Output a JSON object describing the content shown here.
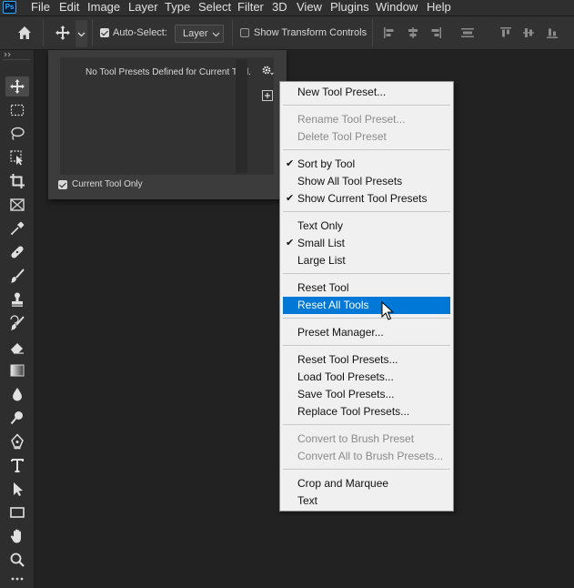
{
  "menubar": {
    "logo": "Ps",
    "items": [
      "File",
      "Edit",
      "Image",
      "Layer",
      "Type",
      "Select",
      "Filter",
      "3D",
      "View",
      "Plugins",
      "Window",
      "Help"
    ]
  },
  "optbar": {
    "auto_select_label": "Auto-Select:",
    "auto_select_checked": true,
    "layer_select_value": "Layer",
    "show_transform_label": "Show Transform Controls",
    "show_transform_checked": false
  },
  "panel": {
    "empty_text": "No Tool Presets Defined for Current Tool.",
    "current_tool_only_label": "Current Tool Only",
    "current_tool_only_checked": true
  },
  "menu": {
    "items": [
      {
        "label": "New Tool Preset...",
        "enabled": true,
        "checked": false,
        "highlighted": false
      },
      {
        "label": "Rename Tool Preset...",
        "enabled": false,
        "checked": false,
        "highlighted": false
      },
      {
        "label": "Delete Tool Preset",
        "enabled": false,
        "checked": false,
        "highlighted": false
      },
      {
        "label": "Sort by Tool",
        "enabled": true,
        "checked": true,
        "highlighted": false
      },
      {
        "label": "Show All Tool Presets",
        "enabled": true,
        "checked": false,
        "highlighted": false
      },
      {
        "label": "Show Current Tool Presets",
        "enabled": true,
        "checked": true,
        "highlighted": false
      },
      {
        "label": "Text Only",
        "enabled": true,
        "checked": false,
        "highlighted": false
      },
      {
        "label": "Small List",
        "enabled": true,
        "checked": true,
        "highlighted": false
      },
      {
        "label": "Large List",
        "enabled": true,
        "checked": false,
        "highlighted": false
      },
      {
        "label": "Reset Tool",
        "enabled": true,
        "checked": false,
        "highlighted": false
      },
      {
        "label": "Reset All Tools",
        "enabled": true,
        "checked": false,
        "highlighted": true
      },
      {
        "label": "Preset Manager...",
        "enabled": true,
        "checked": false,
        "highlighted": false
      },
      {
        "label": "Reset Tool Presets...",
        "enabled": true,
        "checked": false,
        "highlighted": false
      },
      {
        "label": "Load Tool Presets...",
        "enabled": true,
        "checked": false,
        "highlighted": false
      },
      {
        "label": "Save Tool Presets...",
        "enabled": true,
        "checked": false,
        "highlighted": false
      },
      {
        "label": "Replace Tool Presets...",
        "enabled": true,
        "checked": false,
        "highlighted": false
      },
      {
        "label": "Convert to Brush Preset",
        "enabled": false,
        "checked": false,
        "highlighted": false
      },
      {
        "label": "Convert All to Brush Presets...",
        "enabled": false,
        "checked": false,
        "highlighted": false
      },
      {
        "label": "Crop and Marquee",
        "enabled": true,
        "checked": false,
        "highlighted": false
      },
      {
        "label": "Text",
        "enabled": true,
        "checked": false,
        "highlighted": false
      }
    ],
    "checkmark": "✔"
  },
  "toolbar": {
    "tools": [
      "move-tool",
      "marquee-tool",
      "lasso-tool",
      "object-select-tool",
      "crop-tool",
      "frame-tool",
      "eyedropper-tool",
      "healing-brush-tool",
      "brush-tool",
      "clone-stamp-tool",
      "history-brush-tool",
      "eraser-tool",
      "gradient-tool",
      "blur-tool",
      "dodge-tool",
      "pen-tool",
      "type-tool",
      "path-select-tool",
      "rectangle-tool",
      "hand-tool",
      "zoom-tool",
      "more-tools"
    ],
    "active": "move-tool"
  },
  "colors": {
    "accent": "#0078d7",
    "ps_blue": "#31a8ff",
    "menu_bg": "#f0f0f0",
    "disabled_text": "#8a8a8a"
  }
}
